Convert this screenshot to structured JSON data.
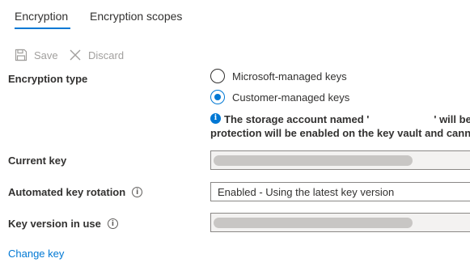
{
  "tabs": [
    {
      "label": "Encryption",
      "active": true
    },
    {
      "label": "Encryption scopes",
      "active": false
    }
  ],
  "toolbar": {
    "save_label": "Save",
    "discard_label": "Discard",
    "save_icon": "floppy-disk-icon",
    "discard_icon": "close-icon"
  },
  "encryption_type": {
    "label": "Encryption type",
    "options": [
      {
        "label": "Microsoft-managed keys",
        "selected": false
      },
      {
        "label": "Customer-managed keys",
        "selected": true
      }
    ]
  },
  "notice": {
    "icon": "info-icon",
    "line1_start": "The storage account named '",
    "line1_end": "' will be g",
    "line2": "protection will be enabled on the key vault and cann"
  },
  "current_key": {
    "label": "Current key"
  },
  "rotation": {
    "label": "Automated key rotation",
    "value": "Enabled - Using the latest key version"
  },
  "key_version": {
    "label": "Key version in use"
  },
  "change_key_link": "Change key",
  "colors": {
    "accent": "#0078d4",
    "disabled": "#a19f9d",
    "text": "#323130"
  }
}
